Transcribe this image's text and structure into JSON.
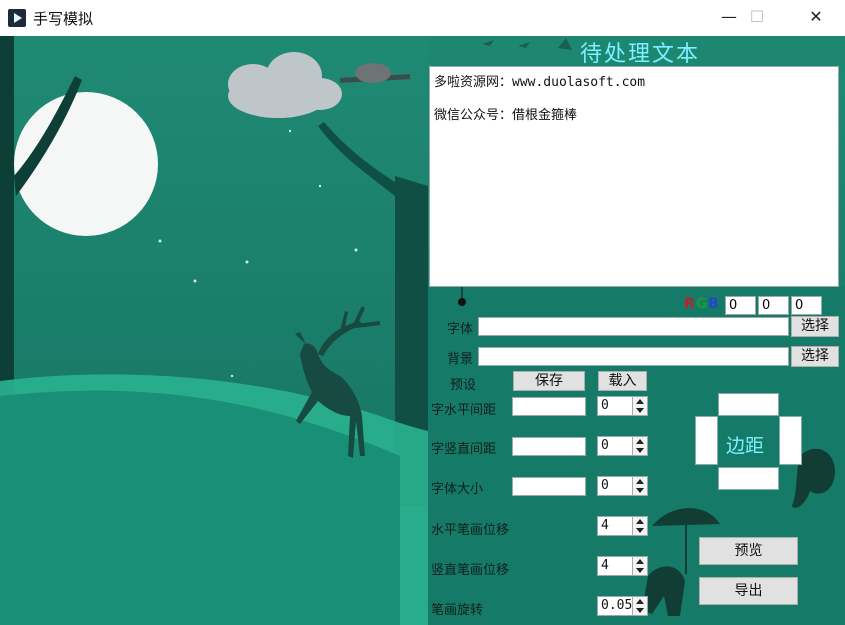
{
  "window": {
    "title": "手写模拟",
    "min": "—",
    "max": "☐",
    "close": "✕"
  },
  "panel_title": "待处理文本",
  "text_content": {
    "line1": "多啦资源网：www.duolasoft.com",
    "line2": "微信公众号：借根金箍棒"
  },
  "rgb": {
    "r_label": "R",
    "g_label": "G",
    "b_label": "B",
    "r": "0",
    "g": "0",
    "b": "0"
  },
  "colors": {
    "r": "#c0202a",
    "g": "#1a9a3a",
    "b": "#2048c8",
    "title": "#7ff0ff"
  },
  "font_row": {
    "label": "字体",
    "value": "",
    "button": "选择"
  },
  "bg_row": {
    "label": "背景",
    "value": "",
    "button": "选择"
  },
  "preset": {
    "label": "预设",
    "save": "保存",
    "load": "载入"
  },
  "h_spacing": {
    "label": "字水平间距",
    "text": "",
    "value": "0"
  },
  "v_spacing": {
    "label": "字竖直间距",
    "text": "",
    "value": "0"
  },
  "font_size": {
    "label": "字体大小",
    "text": "",
    "value": "0"
  },
  "h_stroke": {
    "label": "水平笔画位移",
    "value": "4"
  },
  "v_stroke": {
    "label": "竖直笔画位移",
    "value": "4"
  },
  "rotate": {
    "label": "笔画旋转",
    "value": "0.05"
  },
  "margin_label": "边距",
  "preview_button": "预览",
  "export_button": "导出"
}
